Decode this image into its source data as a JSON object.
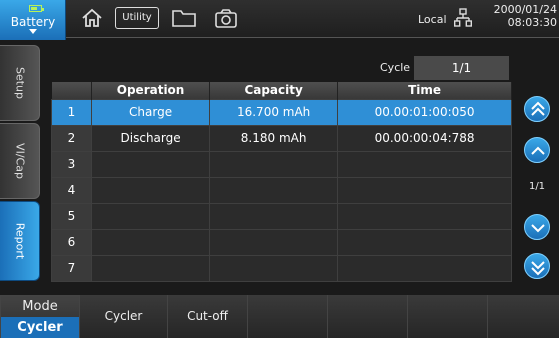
{
  "topbar": {
    "battery_label": "Battery",
    "utility_label": "Utility",
    "local_label": "Local",
    "date": "2000/01/24",
    "time": "08:03:30",
    "icons": [
      "home-icon",
      "utility-icon",
      "folder-icon",
      "camera-icon",
      "network-icon"
    ]
  },
  "side_tabs": [
    {
      "label": "Setup"
    },
    {
      "label": "VI/Cap"
    },
    {
      "label": "Report"
    }
  ],
  "cycle": {
    "label": "Cycle",
    "value": "1/1"
  },
  "table": {
    "headers": [
      "",
      "Operation",
      "Capacity",
      "Time"
    ],
    "rows": [
      {
        "num": "1",
        "operation": "Charge",
        "capacity": "16.700 mAh",
        "time": "00.00:01:00:050"
      },
      {
        "num": "2",
        "operation": "Discharge",
        "capacity": "8.180 mAh",
        "time": "00.00:00:04:788"
      },
      {
        "num": "3",
        "operation": "",
        "capacity": "",
        "time": ""
      },
      {
        "num": "4",
        "operation": "",
        "capacity": "",
        "time": ""
      },
      {
        "num": "5",
        "operation": "",
        "capacity": "",
        "time": ""
      },
      {
        "num": "6",
        "operation": "",
        "capacity": "",
        "time": ""
      },
      {
        "num": "7",
        "operation": "",
        "capacity": "",
        "time": ""
      }
    ]
  },
  "pager": {
    "label": "1/1"
  },
  "bottom": {
    "mode_title": "Mode",
    "mode_value": "Cycler",
    "keys": [
      "Cycler",
      "Cut-off",
      "",
      "",
      "",
      "",
      ""
    ]
  },
  "colors": {
    "accent": "#1b6fb8",
    "highlight": "#2f8fd6",
    "battery_green": "#b6f25a"
  }
}
